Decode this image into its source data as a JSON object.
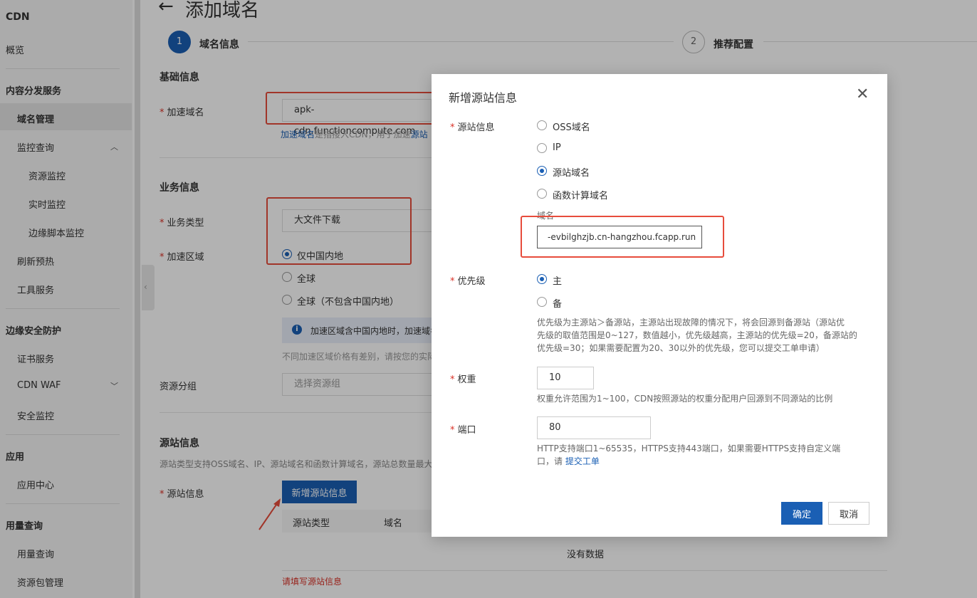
{
  "sidebar": {
    "title": "CDN",
    "overview": "概览",
    "section_content": "内容分发服务",
    "domain_mgmt": "域名管理",
    "monitor_query": "监控查询",
    "resource_monitor": "资源监控",
    "realtime_monitor": "实时监控",
    "edge_script_monitor": "边缘脚本监控",
    "refresh_preheat": "刷新预热",
    "tool_service": "工具服务",
    "section_edge_security": "边缘安全防护",
    "cert_service": "证书服务",
    "cdn_waf": "CDN WAF",
    "security_monitor": "安全监控",
    "section_app": "应用",
    "app_center": "应用中心",
    "section_usage": "用量查询",
    "usage_query": "用量查询",
    "resource_pkg_mgmt": "资源包管理"
  },
  "page": {
    "title": "添加域名",
    "step1_num": "1",
    "step1_label": "域名信息",
    "step2_num": "2",
    "step2_label": "推荐配置"
  },
  "basic": {
    "heading": "基础信息",
    "domain_label": "加速域名",
    "domain_value": "apk-cdn.functioncompute.com",
    "help_link": "加速域名",
    "help_mid": "是指接入CDN，用于加速",
    "help_link2": "源站"
  },
  "business": {
    "heading": "业务信息",
    "type_label": "业务类型",
    "type_value": "大文件下载",
    "region_label": "加速区域",
    "region_options": [
      "仅中国内地",
      "全球",
      "全球（不包含中国内地）"
    ],
    "info_icon": "i",
    "info_text": "加速区域含中国内地时，加速域名",
    "price_note": "不同加速区域价格有差别，请按您的实际",
    "group_label": "资源分组",
    "group_placeholder": "选择资源组"
  },
  "origin": {
    "heading": "源站信息",
    "desc": "源站类型支持OSS域名、IP、源站域名和函数计算域名，源站总数量最大",
    "label": "源站信息",
    "add_button": "新增源站信息",
    "col_type": "源站类型",
    "col_domain": "域名",
    "no_data": "没有数据",
    "error": "请填写源站信息"
  },
  "modal": {
    "title": "新增源站信息",
    "close_icon": "✕",
    "origin_label": "源站信息",
    "origin_options": [
      "OSS域名",
      "IP",
      "源站域名",
      "函数计算域名"
    ],
    "domain_field_label": "域名",
    "domain_value": "-evbilghzjb.cn-hangzhou.fcapp.run",
    "priority_label": "优先级",
    "priority_options": [
      "主",
      "备"
    ],
    "priority_help": [
      "优先级为主源站＞备源站，主源站出现故障的情况下，将会回源到备源站（源站优",
      "先级的取值范围是0~127，数值越小，优先级越高，主源站的优先级=20，备源站的",
      "优先级=30；如果需要配置为20、30以外的优先级，您可以提交工单申请）"
    ],
    "weight_label": "权重",
    "weight_value": "10",
    "weight_help": "权重允许范围为1~100，CDN按照源站的权重分配用户回源到不同源站的比例",
    "port_label": "端口",
    "port_value": "80",
    "port_help_line1": "HTTP支持端口1~65535，HTTPS支持443端口，如果需要HTTPS支持自定义端",
    "port_help_line2": "口，请",
    "port_help_link": "提交工单",
    "confirm": "确定",
    "cancel": "取消"
  },
  "colors": {
    "primary": "#1a5fb4",
    "highlight": "#e74c3c",
    "required": "#d93026"
  }
}
